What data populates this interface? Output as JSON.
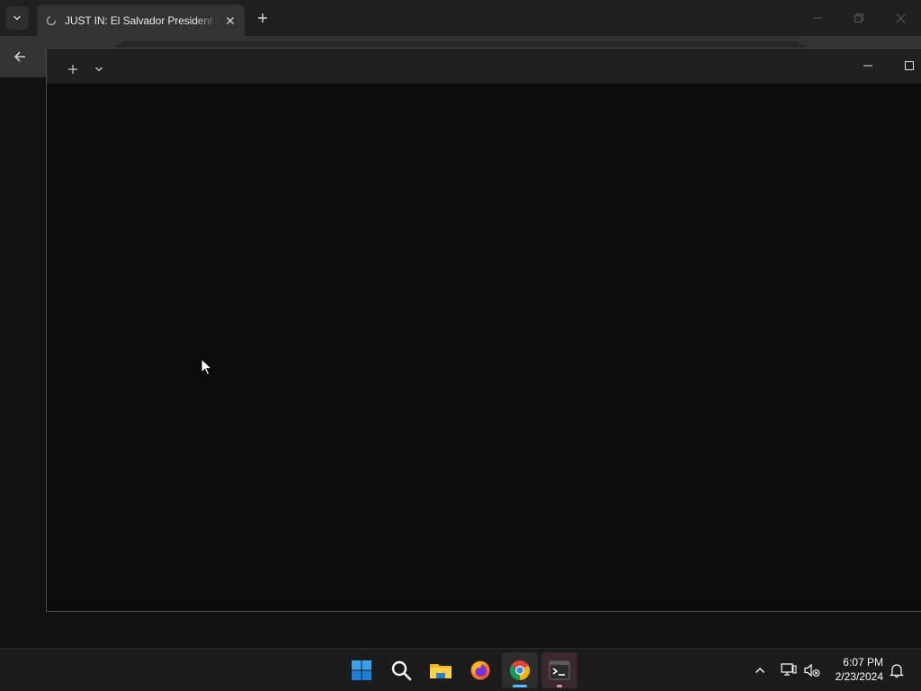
{
  "browser": {
    "tab": {
      "title": "JUST IN: El Salvador President N",
      "favicon": "loading-icon"
    },
    "icons": {
      "tab_list": "chevron-down-icon",
      "tab_close": "close-icon",
      "new_tab": "plus-icon",
      "minimize": "minimize-icon",
      "restore": "restore-icon",
      "close": "close-icon",
      "back": "back-arrow-icon"
    }
  },
  "terminal": {
    "icons": {
      "new_tab": "plus-icon",
      "dropdown": "chevron-down-icon",
      "minimize": "minimize-icon",
      "maximize": "maximize-icon"
    }
  },
  "taskbar": {
    "apps": [
      {
        "name": "Start",
        "icon": "windows-logo-icon"
      },
      {
        "name": "Search",
        "icon": "search-icon"
      },
      {
        "name": "File Explorer",
        "icon": "folder-icon"
      },
      {
        "name": "Firefox",
        "icon": "firefox-icon"
      },
      {
        "name": "Google Chrome",
        "icon": "chrome-icon",
        "active": true
      },
      {
        "name": "Terminal",
        "icon": "terminal-icon",
        "active": true
      }
    ],
    "tray": {
      "time": "6:07 PM",
      "date": "2/23/2024"
    }
  },
  "colors": {
    "accent": "#4cc2ff",
    "terminal_indicator": "#d98ca0",
    "terminal_bg": "#0c0c0c",
    "taskbar_bg": "#1c1c1c"
  }
}
